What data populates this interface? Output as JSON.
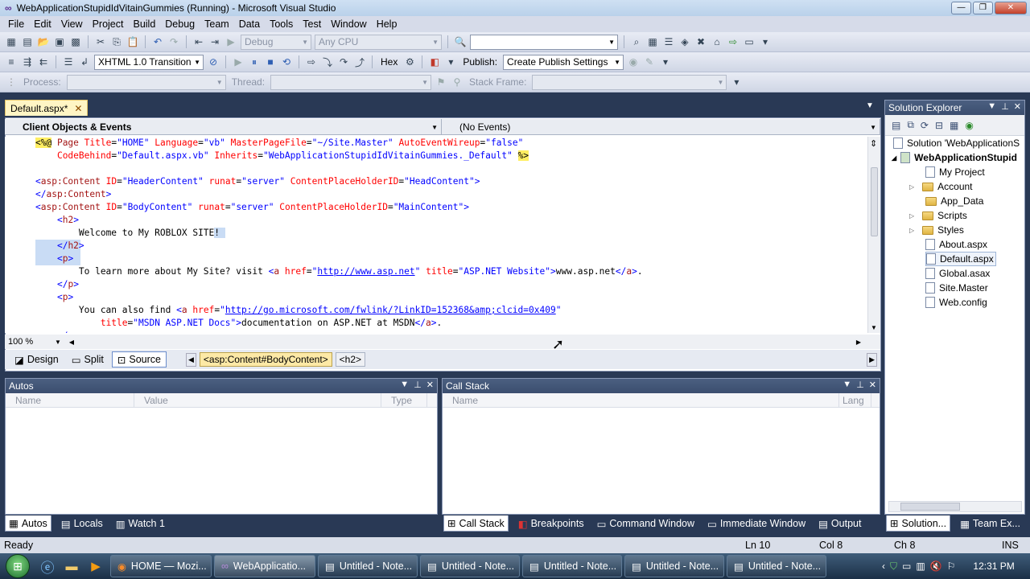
{
  "window": {
    "title": "WebApplicationStupidIdVitainGummies (Running) - Microsoft Visual Studio"
  },
  "menu": [
    "File",
    "Edit",
    "View",
    "Project",
    "Build",
    "Debug",
    "Team",
    "Data",
    "Tools",
    "Test",
    "Window",
    "Help"
  ],
  "toolbar1": {
    "config": "Debug",
    "platform": "Any CPU",
    "find": ""
  },
  "toolbar2": {
    "schema": "XHTML 1.0 Transition",
    "hex": "Hex",
    "publish_label": "Publish:",
    "publish_value": "Create Publish Settings"
  },
  "toolbar3": {
    "process_label": "Process:",
    "thread_label": "Thread:",
    "stack_label": "Stack Frame:"
  },
  "editor": {
    "tab": "Default.aspx*",
    "nav_left": "Client Objects & Events",
    "nav_right": "(No Events)",
    "lines": [
      [
        "<%@ Page Title=\"HOME\" Language=\"vb\" MasterPageFile=\"~/Site.Master\" AutoEventWireup=\"false\""
      ],
      [
        "    CodeBehind=\"Default.aspx.vb\" Inherits=\"WebApplicationStupidIdVitainGummies._Default\" %>"
      ],
      [
        ""
      ],
      [
        "<asp:Content ID=\"HeaderContent\" runat=\"server\" ContentPlaceHolderID=\"HeadContent\">"
      ],
      [
        "</asp:Content>"
      ],
      [
        "<asp:Content ID=\"BodyContent\" runat=\"server\" ContentPlaceHolderID=\"MainContent\">"
      ],
      [
        "    <h2>"
      ],
      [
        "        Welcome to My ROBLOX SITE!"
      ],
      [
        "    </h2>"
      ],
      [
        "    <p>"
      ],
      [
        "        To learn more about My Site? visit <a href=\"http://www.asp.net\" title=\"ASP.NET Website\">www.asp.net</a>."
      ],
      [
        "    </p>"
      ],
      [
        "    <p>"
      ],
      [
        "        You can also find <a href=\"http://go.microsoft.com/fwlink/?LinkID=152368&amp;clcid=0x409\""
      ],
      [
        "            title=\"MSDN ASP.NET Docs\">documentation on ASP.NET at MSDN</a>."
      ]
    ],
    "zoom": "100 %",
    "views": [
      "Design",
      "Split",
      "Source"
    ],
    "breadcrumbs": [
      "<asp:Content#BodyContent>",
      "<h2>"
    ]
  },
  "autos": {
    "title": "Autos",
    "columns": [
      "Name",
      "Value",
      "Type"
    ],
    "tabs": [
      "Autos",
      "Locals",
      "Watch 1"
    ]
  },
  "callstack": {
    "title": "Call Stack",
    "columns": [
      "Name",
      "Lang"
    ],
    "tabs": [
      "Call Stack",
      "Breakpoints",
      "Command Window",
      "Immediate Window",
      "Output"
    ]
  },
  "solution": {
    "title": "Solution Explorer",
    "items": [
      "Solution 'WebApplicationS",
      "WebApplicationStupid",
      "My Project",
      "Account",
      "App_Data",
      "Scripts",
      "Styles",
      "About.aspx",
      "Default.aspx",
      "Global.asax",
      "Site.Master",
      "Web.config"
    ],
    "tabs": [
      "Solution...",
      "Team Ex..."
    ]
  },
  "status": {
    "ready": "Ready",
    "ln": "Ln 10",
    "col": "Col 8",
    "ch": "Ch 8",
    "ins": "INS"
  },
  "taskbar": {
    "items": [
      "HOME — Mozi...",
      "WebApplicatio...",
      "Untitled - Note...",
      "Untitled - Note...",
      "Untitled - Note...",
      "Untitled - Note...",
      "Untitled - Note..."
    ],
    "clock": "12:31 PM"
  }
}
